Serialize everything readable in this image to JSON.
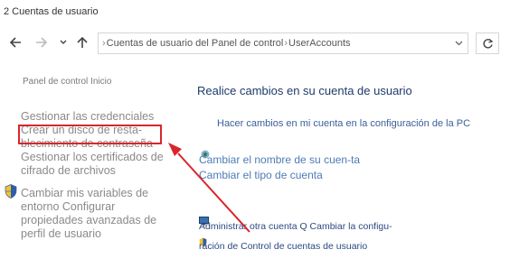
{
  "window": {
    "title": "2 Cuentas de usuario"
  },
  "nav": {
    "back_icon": "arrow-left-icon",
    "forward_icon": "arrow-right-icon",
    "recent_icon": "chevron-down-icon",
    "up_icon": "arrow-up-icon",
    "address_segments": [
      "Cuentas de usuario del Panel de control",
      "UserAccounts"
    ],
    "refresh_icon": "refresh-icon"
  },
  "left_pane": {
    "home_link": "Panel de control Inicio",
    "tasks": [
      {
        "label": "Gestionar las credenciales"
      },
      {
        "label": "Crear un disco de resta-blecimiento de contraseña"
      },
      {
        "label": "Gestionar los certificados de cifrado de archivos"
      },
      {
        "label": "Cambiar mis variables de entorno Configurar propiedades avanzadas de perfil de usuario"
      }
    ]
  },
  "main_pane": {
    "heading": "Realice cambios en su cuenta de usuario",
    "links": [
      {
        "label": "Hacer cambios en mi cuenta en la configuración de la PC"
      },
      {
        "label": "Cambiar el nombre de su cuen-ta Cambiar el tipo de cuenta"
      },
      {
        "label": "Administrar otra cuenta Q Cambiar la configu-ración de Control de cuentas de usuario"
      }
    ]
  },
  "annotation": {
    "highlight_color": "#d9262c",
    "arrow_color": "#d9262c"
  }
}
